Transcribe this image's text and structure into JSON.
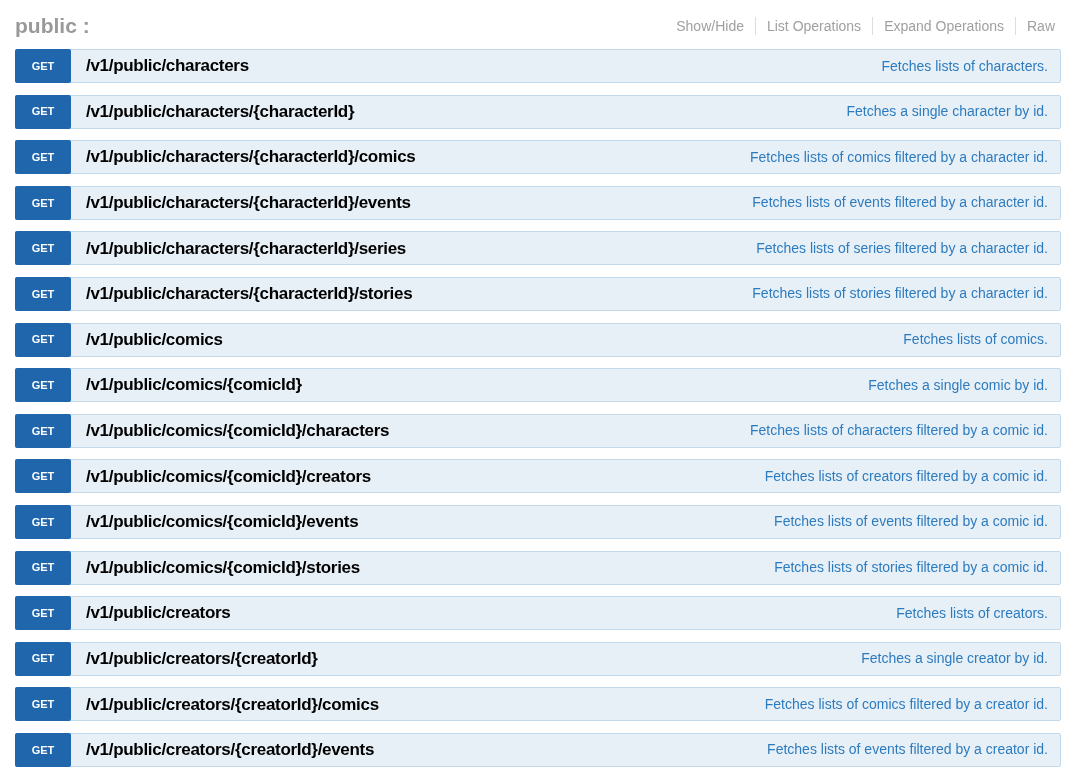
{
  "section": {
    "title": "public :",
    "links": [
      "Show/Hide",
      "List Operations",
      "Expand Operations",
      "Raw"
    ]
  },
  "operations": [
    {
      "method": "GET",
      "path": "/v1/public/characters",
      "summary": "Fetches lists of characters."
    },
    {
      "method": "GET",
      "path": "/v1/public/characters/{characterId}",
      "summary": "Fetches a single character by id."
    },
    {
      "method": "GET",
      "path": "/v1/public/characters/{characterId}/comics",
      "summary": "Fetches lists of comics filtered by a character id."
    },
    {
      "method": "GET",
      "path": "/v1/public/characters/{characterId}/events",
      "summary": "Fetches lists of events filtered by a character id."
    },
    {
      "method": "GET",
      "path": "/v1/public/characters/{characterId}/series",
      "summary": "Fetches lists of series filtered by a character id."
    },
    {
      "method": "GET",
      "path": "/v1/public/characters/{characterId}/stories",
      "summary": "Fetches lists of stories filtered by a character id."
    },
    {
      "method": "GET",
      "path": "/v1/public/comics",
      "summary": "Fetches lists of comics."
    },
    {
      "method": "GET",
      "path": "/v1/public/comics/{comicId}",
      "summary": "Fetches a single comic by id."
    },
    {
      "method": "GET",
      "path": "/v1/public/comics/{comicId}/characters",
      "summary": "Fetches lists of characters filtered by a comic id."
    },
    {
      "method": "GET",
      "path": "/v1/public/comics/{comicId}/creators",
      "summary": "Fetches lists of creators filtered by a comic id."
    },
    {
      "method": "GET",
      "path": "/v1/public/comics/{comicId}/events",
      "summary": "Fetches lists of events filtered by a comic id."
    },
    {
      "method": "GET",
      "path": "/v1/public/comics/{comicId}/stories",
      "summary": "Fetches lists of stories filtered by a comic id."
    },
    {
      "method": "GET",
      "path": "/v1/public/creators",
      "summary": "Fetches lists of creators."
    },
    {
      "method": "GET",
      "path": "/v1/public/creators/{creatorId}",
      "summary": "Fetches a single creator by id."
    },
    {
      "method": "GET",
      "path": "/v1/public/creators/{creatorId}/comics",
      "summary": "Fetches lists of comics filtered by a creator id."
    },
    {
      "method": "GET",
      "path": "/v1/public/creators/{creatorId}/events",
      "summary": "Fetches lists of events filtered by a creator id."
    }
  ]
}
